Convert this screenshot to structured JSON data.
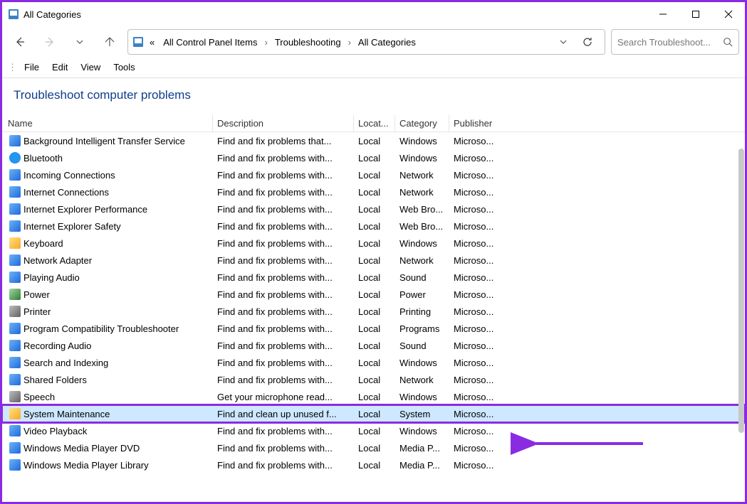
{
  "window": {
    "title": "All Categories"
  },
  "breadcrumbs": {
    "prefix": "«",
    "items": [
      "All Control Panel Items",
      "Troubleshooting",
      "All Categories"
    ]
  },
  "search": {
    "placeholder": "Search Troubleshoot..."
  },
  "menubar": {
    "items": [
      "File",
      "Edit",
      "View",
      "Tools"
    ]
  },
  "heading": "Troubleshoot computer problems",
  "columns": {
    "name": "Name",
    "description": "Description",
    "location": "Locat...",
    "category": "Category",
    "publisher": "Publisher"
  },
  "rows": [
    {
      "icon": "ico",
      "name": "Background Intelligent Transfer Service",
      "description": "Find and fix problems that...",
      "location": "Local",
      "category": "Windows",
      "publisher": "Microso...",
      "selected": false
    },
    {
      "icon": "ico bt",
      "name": "Bluetooth",
      "description": "Find and fix problems with...",
      "location": "Local",
      "category": "Windows",
      "publisher": "Microso...",
      "selected": false
    },
    {
      "icon": "ico",
      "name": "Incoming Connections",
      "description": "Find and fix problems with...",
      "location": "Local",
      "category": "Network",
      "publisher": "Microso...",
      "selected": false
    },
    {
      "icon": "ico",
      "name": "Internet Connections",
      "description": "Find and fix problems with...",
      "location": "Local",
      "category": "Network",
      "publisher": "Microso...",
      "selected": false
    },
    {
      "icon": "ico",
      "name": "Internet Explorer Performance",
      "description": "Find and fix problems with...",
      "location": "Local",
      "category": "Web Bro...",
      "publisher": "Microso...",
      "selected": false
    },
    {
      "icon": "ico",
      "name": "Internet Explorer Safety",
      "description": "Find and fix problems with...",
      "location": "Local",
      "category": "Web Bro...",
      "publisher": "Microso...",
      "selected": false
    },
    {
      "icon": "ico yl",
      "name": "Keyboard",
      "description": "Find and fix problems with...",
      "location": "Local",
      "category": "Windows",
      "publisher": "Microso...",
      "selected": false
    },
    {
      "icon": "ico",
      "name": "Network Adapter",
      "description": "Find and fix problems with...",
      "location": "Local",
      "category": "Network",
      "publisher": "Microso...",
      "selected": false
    },
    {
      "icon": "ico",
      "name": "Playing Audio",
      "description": "Find and fix problems with...",
      "location": "Local",
      "category": "Sound",
      "publisher": "Microso...",
      "selected": false
    },
    {
      "icon": "ico gn",
      "name": "Power",
      "description": "Find and fix problems with...",
      "location": "Local",
      "category": "Power",
      "publisher": "Microso...",
      "selected": false
    },
    {
      "icon": "ico gr",
      "name": "Printer",
      "description": "Find and fix problems with...",
      "location": "Local",
      "category": "Printing",
      "publisher": "Microso...",
      "selected": false
    },
    {
      "icon": "ico",
      "name": "Program Compatibility Troubleshooter",
      "description": "Find and fix problems with...",
      "location": "Local",
      "category": "Programs",
      "publisher": "Microso...",
      "selected": false
    },
    {
      "icon": "ico",
      "name": "Recording Audio",
      "description": "Find and fix problems with...",
      "location": "Local",
      "category": "Sound",
      "publisher": "Microso...",
      "selected": false
    },
    {
      "icon": "ico",
      "name": "Search and Indexing",
      "description": "Find and fix problems with...",
      "location": "Local",
      "category": "Windows",
      "publisher": "Microso...",
      "selected": false
    },
    {
      "icon": "ico",
      "name": "Shared Folders",
      "description": "Find and fix problems with...",
      "location": "Local",
      "category": "Network",
      "publisher": "Microso...",
      "selected": false
    },
    {
      "icon": "ico gr",
      "name": "Speech",
      "description": "Get your microphone read...",
      "location": "Local",
      "category": "Windows",
      "publisher": "Microso...",
      "selected": false
    },
    {
      "icon": "ico yl",
      "name": "System Maintenance",
      "description": "Find and clean up unused f...",
      "location": "Local",
      "category": "System",
      "publisher": "Microso...",
      "selected": true
    },
    {
      "icon": "ico",
      "name": "Video Playback",
      "description": "Find and fix problems with...",
      "location": "Local",
      "category": "Windows",
      "publisher": "Microso...",
      "selected": false
    },
    {
      "icon": "ico",
      "name": "Windows Media Player DVD",
      "description": "Find and fix problems with...",
      "location": "Local",
      "category": "Media P...",
      "publisher": "Microso...",
      "selected": false
    },
    {
      "icon": "ico",
      "name": "Windows Media Player Library",
      "description": "Find and fix problems with...",
      "location": "Local",
      "category": "Media P...",
      "publisher": "Microso...",
      "selected": false
    }
  ]
}
